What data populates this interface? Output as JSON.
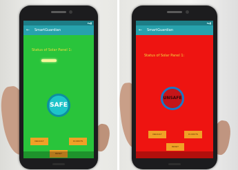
{
  "left_screen": {
    "app_title": "SmartGuardian",
    "status_label": "Status of Solar Panel 1:",
    "badge_text": "SAFE",
    "buttons": [
      "DEFAULT",
      "IN DROTS",
      "RESET"
    ]
  },
  "right_screen": {
    "app_title": "SmartGuardian",
    "status_label": "Status of Solar Panel 1:",
    "badge_text": "UNSAFE",
    "buttons": [
      "DEFAULT",
      "IN DROTS",
      "RESET"
    ]
  },
  "colors": {
    "safe_screen": "#29c43b",
    "unsafe_screen": "#ee1411",
    "app_bar": "#27a2ad",
    "status_text": "#f2de3c",
    "button": "#f0a126"
  },
  "icons": {
    "back": "arrow-left"
  }
}
